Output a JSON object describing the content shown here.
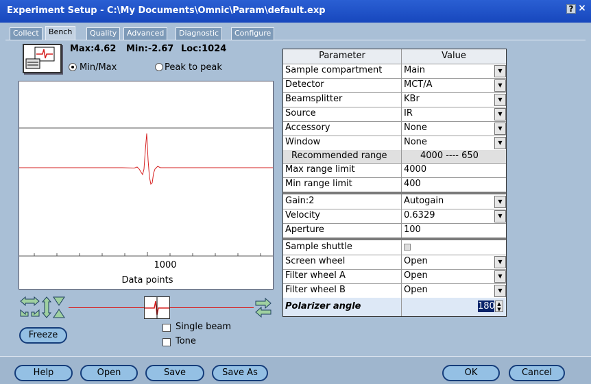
{
  "window": {
    "title": "Experiment Setup - C:\\My Documents\\Omnic\\Param\\default.exp",
    "help_label": "?",
    "close_label": "×"
  },
  "tabs": [
    {
      "label": "Collect",
      "active": false
    },
    {
      "label": "Bench",
      "active": true
    },
    {
      "label": "Quality",
      "active": false
    },
    {
      "label": "Advanced",
      "active": false
    },
    {
      "label": "Diagnostic",
      "active": false
    },
    {
      "label": "Configure",
      "active": false
    }
  ],
  "signal": {
    "max_label": "Max:4.62",
    "min_label": "Min:-2.67",
    "loc_label": "Loc:1024",
    "mode_minmax": "Min/Max",
    "mode_peak": "Peak to peak",
    "selected_mode": "minmax",
    "x_tick_label": "1000",
    "x_axis_label": "Data points",
    "single_beam_label": "Single beam",
    "tone_label": "Tone",
    "freeze_label": "Freeze"
  },
  "table": {
    "header": {
      "parameter": "Parameter",
      "value": "Value"
    },
    "group1": [
      {
        "param": "Sample compartment",
        "value": "Main",
        "dropdown": true
      },
      {
        "param": "Detector",
        "value": "MCT/A",
        "dropdown": true
      },
      {
        "param": "Beamsplitter",
        "value": "KBr",
        "dropdown": true
      },
      {
        "param": "Source",
        "value": "IR",
        "dropdown": true
      },
      {
        "param": "Accessory",
        "value": "None",
        "dropdown": true
      },
      {
        "param": "Window",
        "value": "None",
        "dropdown": true
      }
    ],
    "recommended": {
      "param": "Recommended range",
      "value": "4000 ----  650"
    },
    "group2": [
      {
        "param": "Max range limit",
        "value": "4000",
        "dropdown": false
      },
      {
        "param": "Min range limit",
        "value": "400",
        "dropdown": false
      }
    ],
    "group3": [
      {
        "param": "Gain:2",
        "value": "Autogain",
        "dropdown": true
      },
      {
        "param": "Velocity",
        "value": "0.6329",
        "dropdown": true
      },
      {
        "param": "Aperture",
        "value": "100",
        "dropdown": false
      }
    ],
    "group4": [
      {
        "param": "Sample shuttle",
        "value": "",
        "dropdown": false
      },
      {
        "param": "Screen wheel",
        "value": "Open",
        "dropdown": true
      },
      {
        "param": "Filter wheel A",
        "value": "Open",
        "dropdown": true
      },
      {
        "param": "Filter wheel B",
        "value": "Open",
        "dropdown": true
      }
    ],
    "polarizer": {
      "param": "Polarizer angle",
      "value": "180"
    }
  },
  "buttons": {
    "help": "Help",
    "open": "Open",
    "save": "Save",
    "save_as": "Save As",
    "ok": "OK",
    "cancel": "Cancel"
  },
  "colors": {
    "accent": "#1747bd",
    "trace": "#d62020",
    "button": "#94c0e4"
  }
}
